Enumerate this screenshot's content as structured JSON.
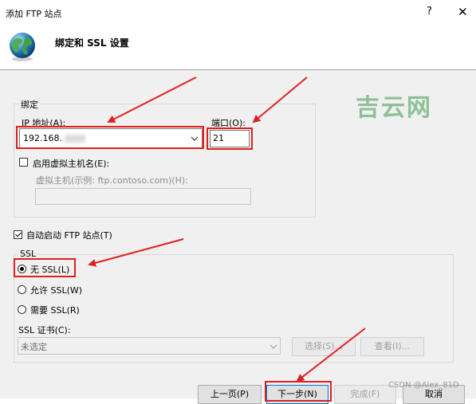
{
  "window": {
    "title": "添加 FTP 站点",
    "help_glyph": "?",
    "close_glyph": "✕"
  },
  "header": {
    "title": "绑定和 SSL 设置",
    "icon": "globe-icon"
  },
  "binding": {
    "group_label": "绑定",
    "ip_label": "IP 地址(A):",
    "ip_value": "192.168.",
    "port_label": "端口(O):",
    "port_value": "21",
    "vhost_checkbox_label": "启用虚拟主机名(E):",
    "vhost_checked": false,
    "vhost_field_label": "虚拟主机(示例: ftp.contoso.com)(H):",
    "vhost_value": ""
  },
  "autostart": {
    "label": "自动启动 FTP 站点(T)",
    "checked": true
  },
  "ssl": {
    "group_label": "SSL",
    "options": [
      "无 SSL(L)",
      "允许 SSL(W)",
      "需要 SSL(R)"
    ],
    "selected": "无 SSL(L)",
    "cert_label": "SSL 证书(C):",
    "cert_value": "未选定",
    "select_button": "选择(S)...",
    "view_button": "查看(I)..."
  },
  "footer": {
    "prev_button": "上一页(P)",
    "next_button": "下一步(N)",
    "finish_button": "完成(F)",
    "cancel_button": "取消"
  },
  "watermark": "吉云网",
  "credit": "CSDN @Alex_81D",
  "colors": {
    "annotation_red": "#e02020",
    "dialog_bg": "#f0f0f0",
    "accent": "#0078d7"
  }
}
